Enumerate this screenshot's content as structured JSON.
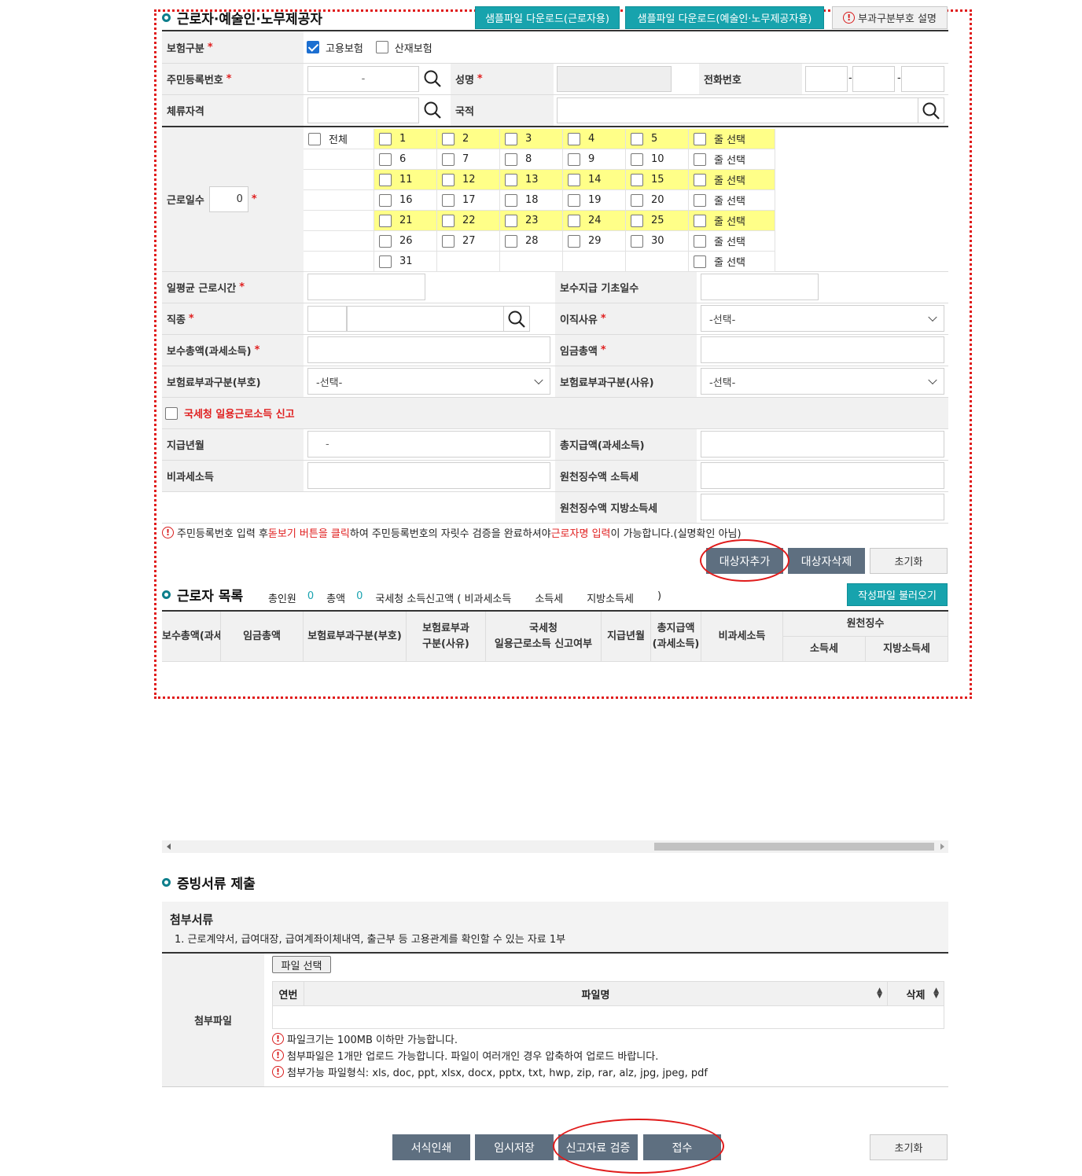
{
  "worker_section": {
    "title": "근로자·예술인·노무제공자",
    "btn_sample_worker": "샘플파일 다운로드(근로자용)",
    "btn_sample_artist": "샘플파일 다운로드(예술인·노무제공자용)",
    "btn_explain": "부과구분부호 설명",
    "insurance_type_label": "보험구분",
    "insurance_options": [
      "고용보험",
      "산재보험"
    ],
    "resident_no_label": "주민등록번호",
    "resident_no_placeholder": "-",
    "name_label": "성명",
    "phone_label": "전화번호",
    "phone_sep": "-",
    "stay_label": "체류자격",
    "nationality_label": "국적",
    "workdays_label": "근로일수",
    "workdays_value": "0",
    "all_label": "전체",
    "row_select_label": "줄 선택",
    "days": [
      "1",
      "2",
      "3",
      "4",
      "5",
      "6",
      "7",
      "8",
      "9",
      "10",
      "11",
      "12",
      "13",
      "14",
      "15",
      "16",
      "17",
      "18",
      "19",
      "20",
      "21",
      "22",
      "23",
      "24",
      "25",
      "26",
      "27",
      "28",
      "29",
      "30",
      "31"
    ],
    "avg_hours_label": "일평균 근로시간",
    "pay_base_days_label": "보수지급 기초일수",
    "job_label": "직종",
    "leave_reason_label": "이직사유",
    "select_placeholder": "-선택-",
    "total_pay_label": "보수총액(과세소득)",
    "total_wage_label": "임금총액",
    "levy_code_label": "보험료부과구분(부호)",
    "levy_reason_label": "보험료부과구분(사유)",
    "nts_report_label": "국세청 일용근로소득 신고",
    "pay_month_label": "지급년월",
    "pay_month_placeholder": "-",
    "total_paid_label": "총지급액(과세소득)",
    "nontax_label": "비과세소득",
    "withhold_income_label": "원천징수액 소득세",
    "withhold_local_label": "원천징수액 지방소득세",
    "notice_parts": [
      "주민등록번호 입력 후 ",
      "돋보기 버튼을 클릭",
      "하여 주민등록번호의 자릿수 검증을 완료하셔야 ",
      "근로자명 입력",
      "이 가능합니다.(실명확인 아님)"
    ],
    "btn_add": "대상자추가",
    "btn_delete": "대상자삭제",
    "btn_reset": "초기화"
  },
  "worker_list": {
    "title": "근로자 목록",
    "total_people_label": "총인원",
    "total_people_value": "0",
    "total_amount_label": "총액",
    "total_amount_value": "0",
    "nts_summary": "국세청 소득신고액 ( 비과세소득",
    "income_tax": "소득세",
    "local_tax": "지방소득세",
    "close_paren": ")",
    "btn_load": "작성파일 불러오기",
    "headers": {
      "total_pay": "보수총액(과세",
      "total_wage": "임금총액",
      "levy_code": "보험료부과구분(부호)",
      "levy_reason_1": "보험료부과",
      "levy_reason_2": "구분(사유)",
      "nts_1": "국세청",
      "nts_2": "일용근로소득 신고여부",
      "pay_month": "지급년월",
      "total_paid_1": "총지급액",
      "total_paid_2": "(과세소득)",
      "nontax": "비과세소득",
      "withhold": "원천징수",
      "income_tax": "소득세",
      "local_tax": "지방소득세"
    }
  },
  "evidence": {
    "title": "증빙서류 제출",
    "attach_docs_title": "첨부서류",
    "attach_docs_item": "1. 근로계약서, 급여대장, 급여계좌이체내역, 출근부 등 고용관계를 확인할 수 있는 자료 1부",
    "attach_file_label": "첨부파일",
    "btn_file_select": "파일 선택",
    "col_no": "연번",
    "col_filename": "파일명",
    "col_delete": "삭제",
    "notes": [
      "파일크기는 100MB 이하만 가능합니다.",
      "첨부파일은 1개만 업로드 가능합니다. 파일이 여러개인 경우 압축하여 업로드 바랍니다.",
      "첨부가능 파일형식: xls, doc, ppt, xlsx, docx, pptx, txt, hwp, zip, rar, alz, jpg, jpeg, pdf"
    ]
  },
  "footer": {
    "btn_print": "서식인쇄",
    "btn_temp_save": "임시저장",
    "btn_verify": "신고자료 검증",
    "btn_submit": "접수",
    "btn_reset": "초기화"
  }
}
